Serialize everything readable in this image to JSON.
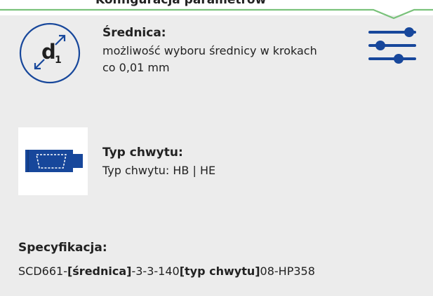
{
  "top": {
    "title": "Konfiguracja parametrów"
  },
  "diameter": {
    "icon_main": "d",
    "icon_sub": "1",
    "title": "Średnica:",
    "description": "możliwość wyboru średnicy w krokach co 0,01 mm"
  },
  "clamp": {
    "title": "Typ chwytu:",
    "description": "Typ chwytu: HB | HE"
  },
  "spec": {
    "title": "Specyfikacja:",
    "code_prefix": "SCD661-",
    "diameter_token": "[średnica]",
    "code_middle": "-3-3-140",
    "clamp_token": "[typ chwytu]",
    "code_suffix": "08-HP358"
  },
  "icons": {
    "diameter": "diameter-circle-icon",
    "adjust": "sliders-icon",
    "clamp": "tool-holder-icon",
    "arrow": "dropdown-chevron-icon"
  },
  "colors": {
    "accent_green": "#7ac27b",
    "brand_blue": "#17479b",
    "panel_bg": "#ececec"
  }
}
